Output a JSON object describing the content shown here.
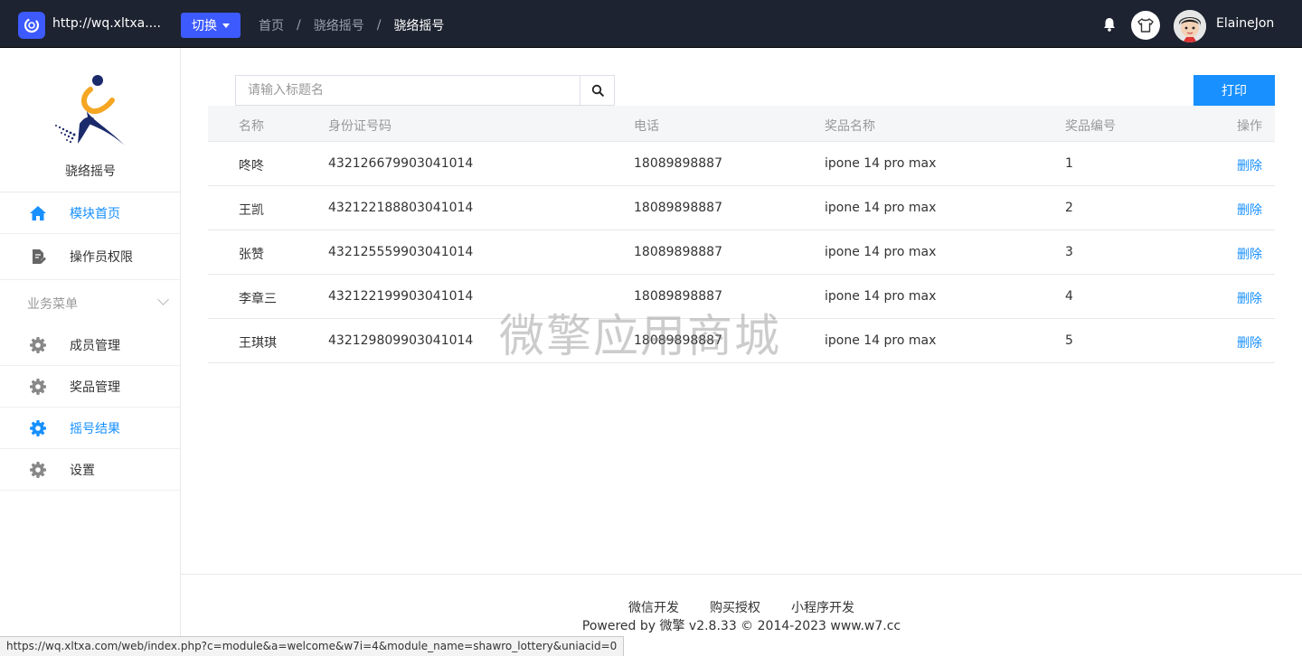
{
  "topbar": {
    "site_url": "http://wq.xltxa....",
    "switch_label": "切换",
    "breadcrumb": [
      "首页",
      "骁络摇号",
      "骁络摇号"
    ],
    "username": "ElaineJon"
  },
  "sidebar": {
    "brand_name": "骁络摇号",
    "items": [
      {
        "label": "模块首页",
        "icon": "home-icon",
        "active": true
      },
      {
        "label": "操作员权限",
        "icon": "edit-doc-icon",
        "active": false
      }
    ],
    "group_title": "业务菜单",
    "group_items": [
      {
        "label": "成员管理",
        "icon": "gear-icon",
        "active": false
      },
      {
        "label": "奖品管理",
        "icon": "gear-icon",
        "active": false
      },
      {
        "label": "摇号结果",
        "icon": "gear-icon",
        "active": true
      },
      {
        "label": "设置",
        "icon": "gear-icon",
        "active": false
      }
    ]
  },
  "search": {
    "placeholder": "请输入标题名"
  },
  "print_label": "打印",
  "table": {
    "headers": [
      "名称",
      "身份证号码",
      "电话",
      "奖品名称",
      "奖品编号",
      "操作"
    ],
    "rows": [
      {
        "name": "咚咚",
        "id": "432126679903041014",
        "phone": "18089898887",
        "prize": "ipone 14 pro max",
        "no": "1",
        "action": "删除"
      },
      {
        "name": "王凯",
        "id": "432122188803041014",
        "phone": "18089898887",
        "prize": "ipone 14 pro max",
        "no": "2",
        "action": "删除"
      },
      {
        "name": "张赞",
        "id": "432125559903041014",
        "phone": "18089898887",
        "prize": "ipone 14 pro max",
        "no": "3",
        "action": "删除"
      },
      {
        "name": "李章三",
        "id": "432122199903041014",
        "phone": "18089898887",
        "prize": "ipone 14 pro max",
        "no": "4",
        "action": "删除"
      },
      {
        "name": "王琪琪",
        "id": "432129809903041014",
        "phone": "18089898887",
        "prize": "ipone 14 pro max",
        "no": "5",
        "action": "删除"
      }
    ]
  },
  "watermark": "微擎应用商城",
  "footer": {
    "links": [
      "微信开发",
      "购买授权",
      "小程序开发"
    ],
    "powered": "Powered by 微擎 v2.8.33 © 2014-2023 www.w7.cc"
  },
  "statusbar": "https://wq.xltxa.com/web/index.php?c=module&a=welcome&w7i=4&module_name=shawro_lottery&uniacid=0",
  "colors": {
    "accent": "#1890ff",
    "topbar": "#1d2330",
    "switch": "#3d5afe"
  }
}
